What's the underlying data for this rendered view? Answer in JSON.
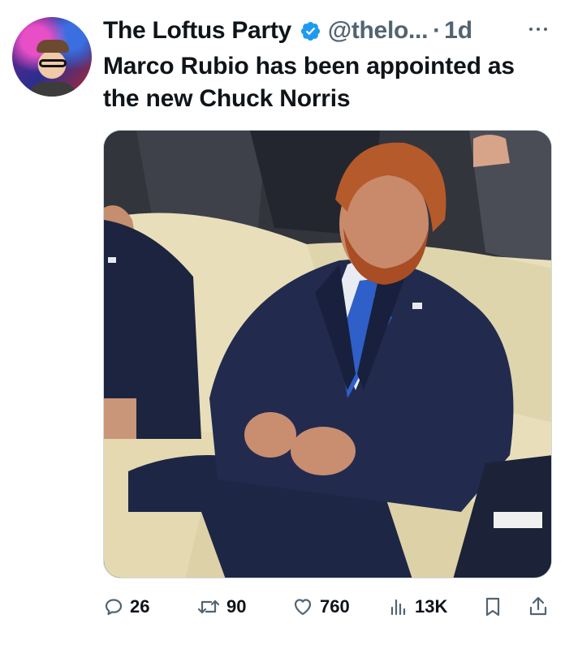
{
  "post": {
    "author": {
      "display_name": "The Loftus Party",
      "verified": true,
      "handle": "@thelo...",
      "separator": "·",
      "time": "1d"
    },
    "text": "Marco Rubio has been appointed as the new Chuck Norris",
    "more_icon": "ellipsis-icon",
    "media": {
      "alt": "Photo of a man with a red beard in a navy suit and blue tie seated on a cream sofa"
    },
    "metrics": {
      "replies": "26",
      "reposts": "90",
      "likes": "760",
      "views": "13K"
    },
    "icons": {
      "reply": "speech-bubble-icon",
      "repost": "repost-arrows-icon",
      "like": "heart-icon",
      "views": "bar-chart-icon",
      "bookmark": "bookmark-icon",
      "share": "share-upload-icon"
    },
    "colors": {
      "text": "#0f1419",
      "secondary": "#536471",
      "verified": "#1d9bf0"
    }
  }
}
